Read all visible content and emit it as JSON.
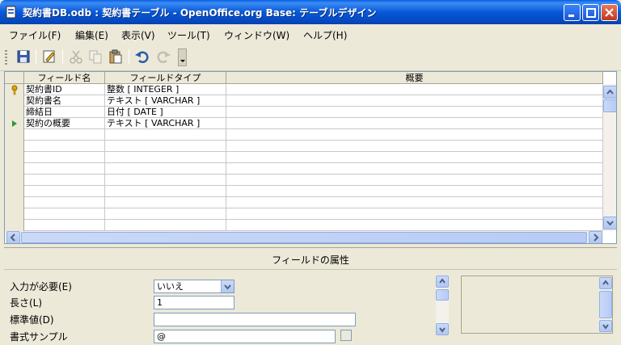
{
  "window": {
    "title": "契約書DB.odb : 契約書テーブル - OpenOffice.org Base: テーブルデザイン"
  },
  "menu": [
    {
      "label": "ファイル(F)"
    },
    {
      "label": "編集(E)"
    },
    {
      "label": "表示(V)"
    },
    {
      "label": "ツール(T)"
    },
    {
      "label": "ウィンドウ(W)"
    },
    {
      "label": "ヘルプ(H)"
    }
  ],
  "toolbar": {
    "icons": [
      "save-icon",
      "edit-icon",
      "cut-icon",
      "copy-icon",
      "paste-icon",
      "undo-icon",
      "redo-icon"
    ]
  },
  "grid": {
    "headers": {
      "name": "フィールド名",
      "type": "フィールドタイプ",
      "description": "概要"
    },
    "rows": [
      {
        "name": "契約書ID",
        "type": "整数 [ INTEGER ]",
        "description": "",
        "marker": "primary-key"
      },
      {
        "name": "契約書名",
        "type": "テキスト [ VARCHAR ]",
        "description": "",
        "marker": ""
      },
      {
        "name": "締結日",
        "type": "日付 [ DATE ]",
        "description": "",
        "marker": ""
      },
      {
        "name": "契約の概要",
        "type": "テキスト [ VARCHAR ]",
        "description": "",
        "marker": "current"
      }
    ]
  },
  "properties": {
    "title": "フィールドの属性",
    "required_label": "入力が必要(E)",
    "required_value": "いいえ",
    "length_label": "長さ(L)",
    "length_value": "1",
    "default_label": "標準値(D)",
    "default_value": "",
    "format_label": "書式サンプル",
    "format_value": "@"
  },
  "colors": {
    "titlebar": "#0858d8",
    "background": "#ece9d8",
    "primary_key_icon": "#e0a800",
    "current_row_marker": "#2e9a2e"
  }
}
